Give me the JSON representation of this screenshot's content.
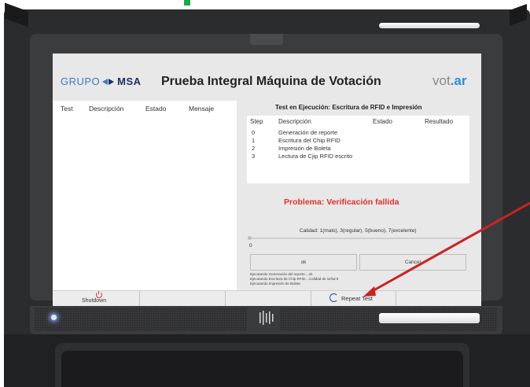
{
  "header": {
    "logo_left_a": "GRUPO",
    "logo_left_b": "MSA",
    "title": "Prueba Integral Máquina de Votación",
    "logo_right_a": "vot",
    "logo_right_b": ".ar"
  },
  "left_table": {
    "columns": [
      "Test",
      "Descripción",
      "Estado",
      "Mensaje"
    ]
  },
  "right_panel": {
    "title": "Test en Ejecución: Escritura de RFID e Impresión",
    "columns": [
      "Step",
      "Descripción",
      "Estado",
      "Resultado"
    ],
    "steps": [
      {
        "num": "0",
        "desc": "Generación de reporte"
      },
      {
        "num": "1",
        "desc": "Escritura del Chip RFID"
      },
      {
        "num": "2",
        "desc": "Impresión de Boleta"
      },
      {
        "num": "3",
        "desc": "Lectura de Cjip RFID escrito"
      }
    ],
    "problem": "Problema: Verificación fallida",
    "calidad_label": "Calidad: 1(malo), 3(regular), 5(bueno), 7(excelente)",
    "slider_value": "0",
    "ok_label": "ok",
    "cancel_label": "Cancel",
    "log": [
      "Ejecutando Generación del reporte....ok",
      "Ejecutando Escritura de Chip RFID....Calidad de señal 5",
      "Ejecutando Impresión de Boleta"
    ]
  },
  "taskbar": {
    "shutdown_label": "Shutdown",
    "repeat_label": "Repeat Test"
  },
  "colors": {
    "problem": "#e03030",
    "accent_blue": "#1e4fa8",
    "annotation_arrow": "#cc2222",
    "brand_green": "#19a84a"
  },
  "icons": [
    "power-icon",
    "repeat-icon",
    "led-indicator",
    "nfc-reader-icon"
  ]
}
